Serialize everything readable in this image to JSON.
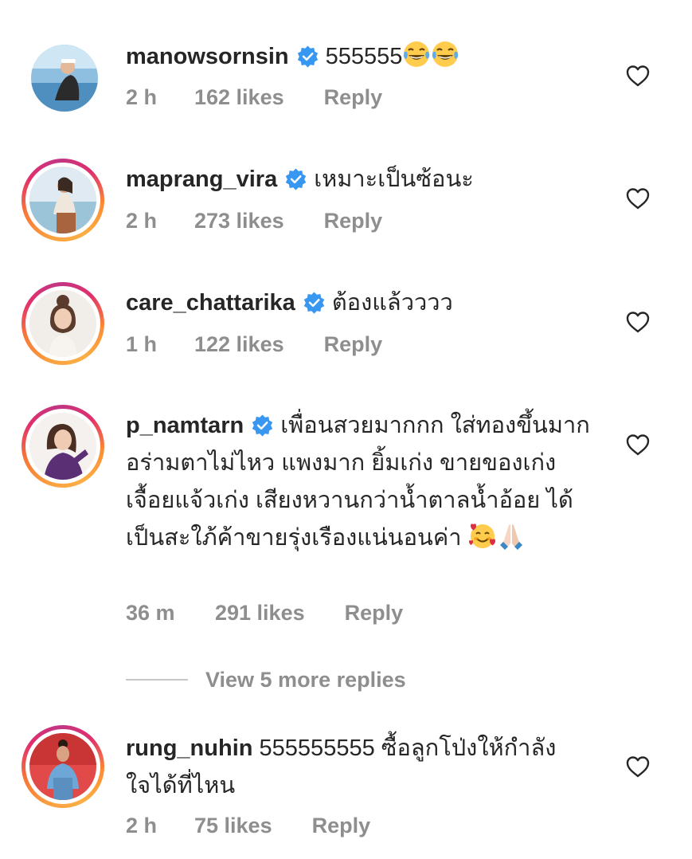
{
  "comments": [
    {
      "username": "manowsornsin",
      "verified": true,
      "text": "555555",
      "emoji": [
        "face-with-tears-of-joy",
        "face-with-tears-of-joy"
      ],
      "time": "2 h",
      "likes": "162 likes",
      "reply": "Reply"
    },
    {
      "username": "maprang_vira",
      "verified": true,
      "text": "เหมาะเป็นซ้อนะ",
      "time": "2 h",
      "likes": "273 likes",
      "reply": "Reply"
    },
    {
      "username": "care_chattarika",
      "verified": true,
      "text": "ต้องแล้วววว",
      "time": "1 h",
      "likes": "122 likes",
      "reply": "Reply"
    },
    {
      "username": "p_namtarn",
      "verified": true,
      "text": "เพื่อนสวยมากกก ใส่ทองขึ้นมาก อร่ามตาไม่ไหว แพงมาก ยิ้มเก่ง ขายของเก่ง เจื้อยแจ้วเก่ง เสียงหวานกว่าน้ำตาลน้ำอ้อย ได้เป็นสะใภ้ค้าขายรุ่งเรืองแน่นอนค่า",
      "emoji": [
        "smiling-face-with-hearts",
        "folded-hands"
      ],
      "time": "36 m",
      "likes": "291 likes",
      "reply": "Reply"
    },
    {
      "username": "rung_nuhin",
      "verified": false,
      "text": "555555555 ซื้อลูกโป่งให้กำลังใจได้ที่ไหน",
      "time": "2 h",
      "likes": "75 likes",
      "reply": "Reply"
    }
  ],
  "view_more": "View 5 more replies",
  "icons": {
    "verified": "verified-badge-icon",
    "like": "heart-outline-icon"
  },
  "colors": {
    "verified": "#3897f0",
    "muted": "#8e8e8e",
    "text": "#262626"
  }
}
